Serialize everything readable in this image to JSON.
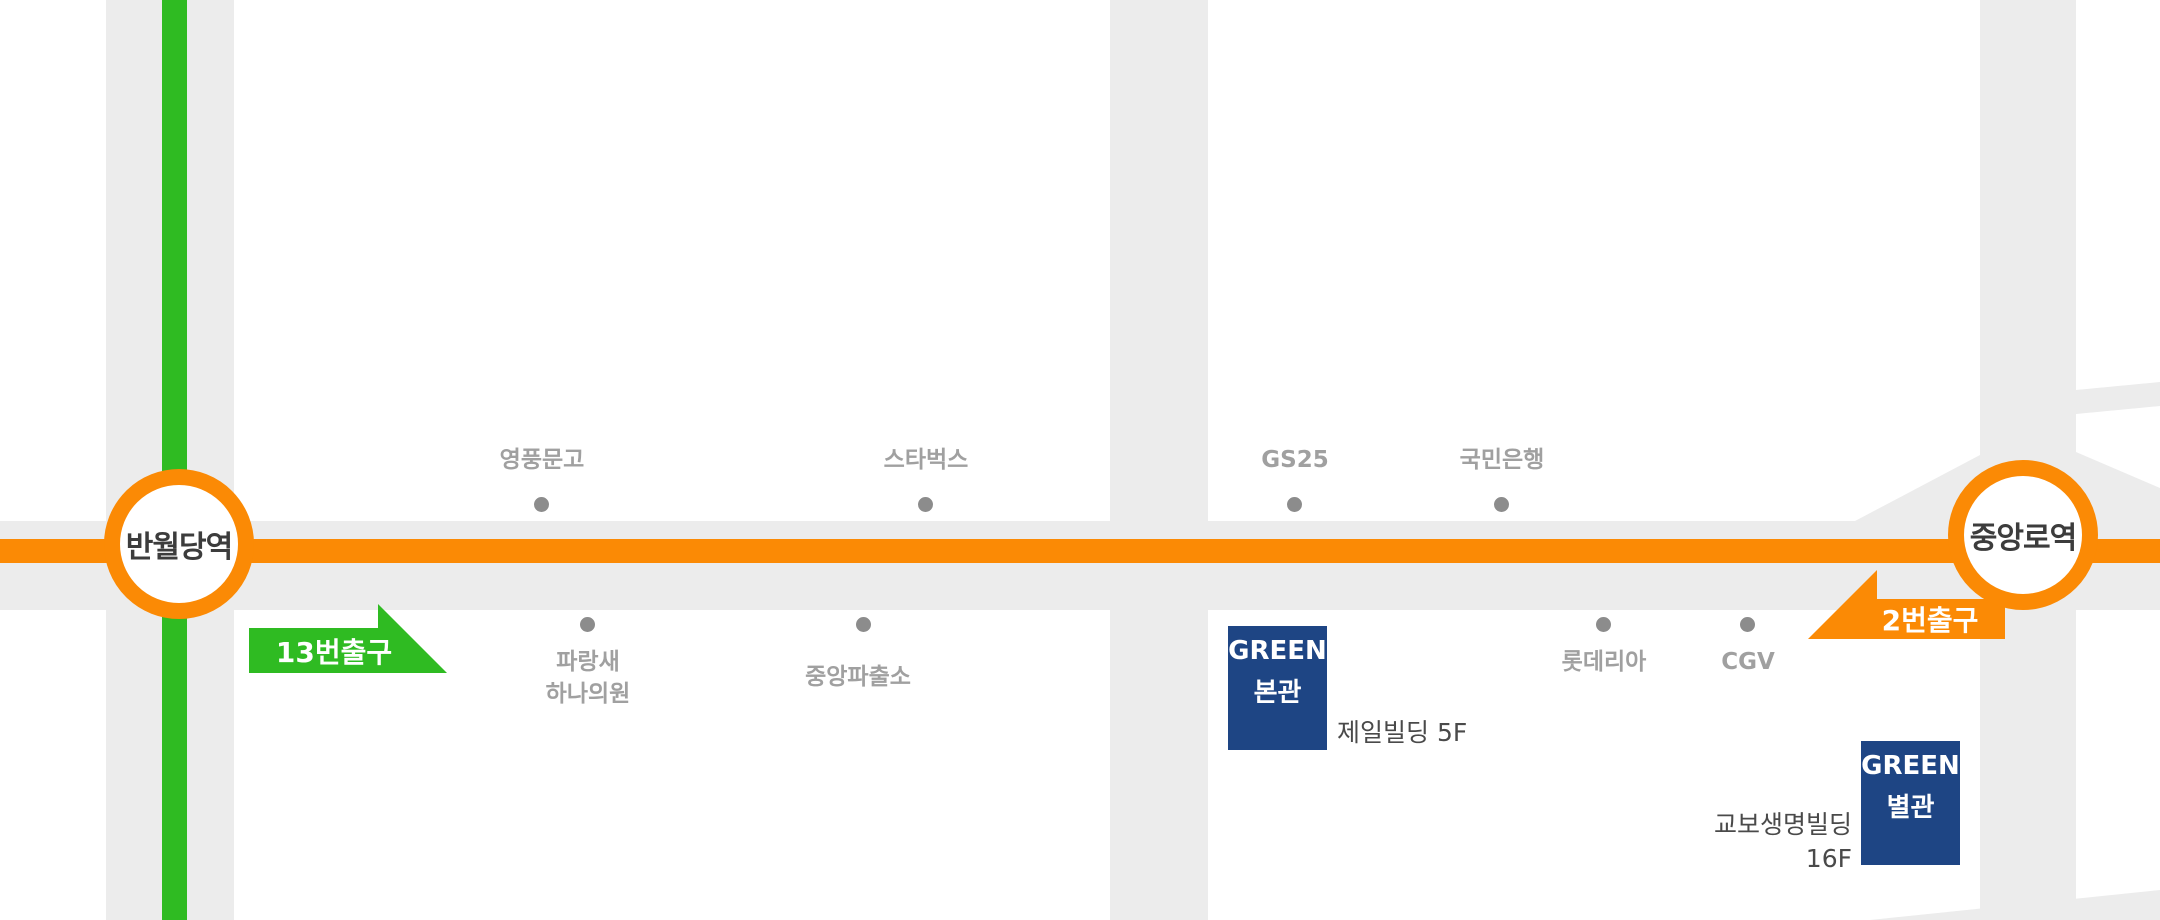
{
  "colors": {
    "road": "#ececec",
    "line_orange": "#fb8a05",
    "line_green": "#2fbb22",
    "building": "#1e4584",
    "poi_dot": "#8c8c8c",
    "poi_text": "#a0a0a0"
  },
  "stations": [
    {
      "name": "반월당역"
    },
    {
      "name": "중앙로역"
    }
  ],
  "exits": [
    {
      "label": "13번출구",
      "color": "#2fbb22"
    },
    {
      "label": "2번출구",
      "color": "#fb8a05"
    }
  ],
  "pois": [
    {
      "name": "영풍문고"
    },
    {
      "name": "스타벅스"
    },
    {
      "name": "GS25"
    },
    {
      "name": "국민은행"
    },
    {
      "name": "파랑새\n하나의원"
    },
    {
      "name": "중앙파출소"
    },
    {
      "name": "롯데리아"
    },
    {
      "name": "CGV"
    }
  ],
  "buildings": [
    {
      "line1": "GREEN",
      "line2": "본관",
      "floor": "제일빌딩 5F"
    },
    {
      "line1": "GREEN",
      "line2": "별관",
      "floor": "교보생명빌딩\n16F"
    }
  ]
}
